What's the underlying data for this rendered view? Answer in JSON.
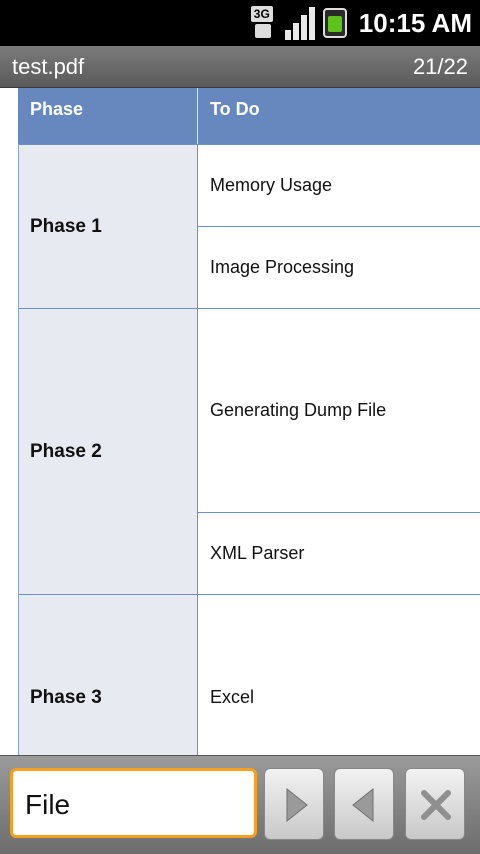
{
  "status_bar": {
    "network_icon": "3g-icon",
    "signal_icon": "signal-icon",
    "battery_icon": "battery-icon",
    "time": "10:15 AM"
  },
  "title_bar": {
    "title": "test.pdf",
    "page_count": "21/22"
  },
  "table": {
    "headers": [
      "Phase",
      "To Do"
    ],
    "rows": [
      {
        "phase": "Phase 1",
        "todos": [
          "Memory Usage",
          "Image Processing"
        ]
      },
      {
        "phase": "Phase 2",
        "todos": [
          "Generating Dump File",
          "XML Parser"
        ]
      },
      {
        "phase": "Phase 3",
        "todos": [
          "Excel"
        ]
      }
    ]
  },
  "find_bar": {
    "search_value": "File",
    "next_icon": "next-icon",
    "prev_icon": "previous-icon",
    "close_icon": "close-icon",
    "accent_color": "#f5a01e"
  }
}
